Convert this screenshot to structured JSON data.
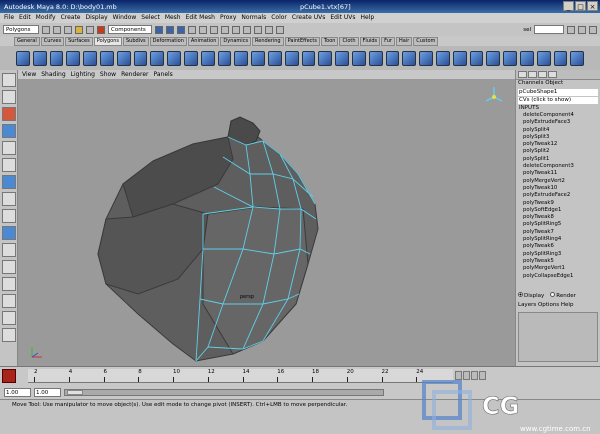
{
  "window": {
    "app_title": "Autodesk Maya 8.0: D:\\body01.mb",
    "object_title": "pCube1.vtx[67]"
  },
  "menubar": [
    "File",
    "Edit",
    "Modify",
    "Create",
    "Display",
    "Window",
    "Select",
    "Mesh",
    "Edit Mesh",
    "Proxy",
    "Normals",
    "Color",
    "Create UVs",
    "Edit UVs",
    "Help"
  ],
  "statusline": {
    "mode_menu": "Polygons",
    "select_mode": "Components",
    "field_label": "sel"
  },
  "shelf_tabs": [
    "General",
    "Curves",
    "Surfaces",
    "Polygons",
    "Subdivs",
    "Deformation",
    "Animation",
    "Dynamics",
    "Rendering",
    "PaintEffects",
    "Toon",
    "Cloth",
    "Fluids",
    "Fur",
    "Hair",
    "Custom"
  ],
  "active_shelf_tab": "Polygons",
  "view_menu": [
    "View",
    "Shading",
    "Lighting",
    "Show",
    "Renderer",
    "Panels"
  ],
  "viewport": {
    "camera_label": "persp"
  },
  "channel_box": {
    "menu": "Channels Object",
    "shape_node": "pCubeShape1",
    "cvs_row": "CVs (click to show)",
    "inputs_label": "INPUTS",
    "history": [
      "deleteComponent4",
      "polyExtrudeFace3",
      "polySplit4",
      "polySplit3",
      "polyTweak12",
      "polySplit2",
      "polySplit1",
      "deleteComponent3",
      "polyTweak11",
      "polyMergeVert2",
      "polyTweak10",
      "polyExtrudeFace2",
      "polyTweak9",
      "polySoftEdge1",
      "polyTweak8",
      "polySplitRing5",
      "polyTweak7",
      "polySplitRing4",
      "polyTweak6",
      "polySplitRing3",
      "polyTweak5",
      "polyMergeVert1",
      "polyCollapseEdge1"
    ],
    "radio_display": "Display",
    "radio_render": "Render",
    "layers_menu": "Layers Options Help"
  },
  "timeline": {
    "ticks": [
      "2",
      "4",
      "6",
      "8",
      "10",
      "12",
      "14",
      "16",
      "18",
      "20",
      "22",
      "24"
    ],
    "start_field": "1.00",
    "start_field2": "1.00"
  },
  "help_line": "Move Tool: Use manipulator to move object(s). Use edit mode to change pivot (INSERT). Ctrl+LMB to move perpendicular.",
  "watermark": {
    "brand": "CG",
    "site": "www.cgtime.com.cn"
  }
}
